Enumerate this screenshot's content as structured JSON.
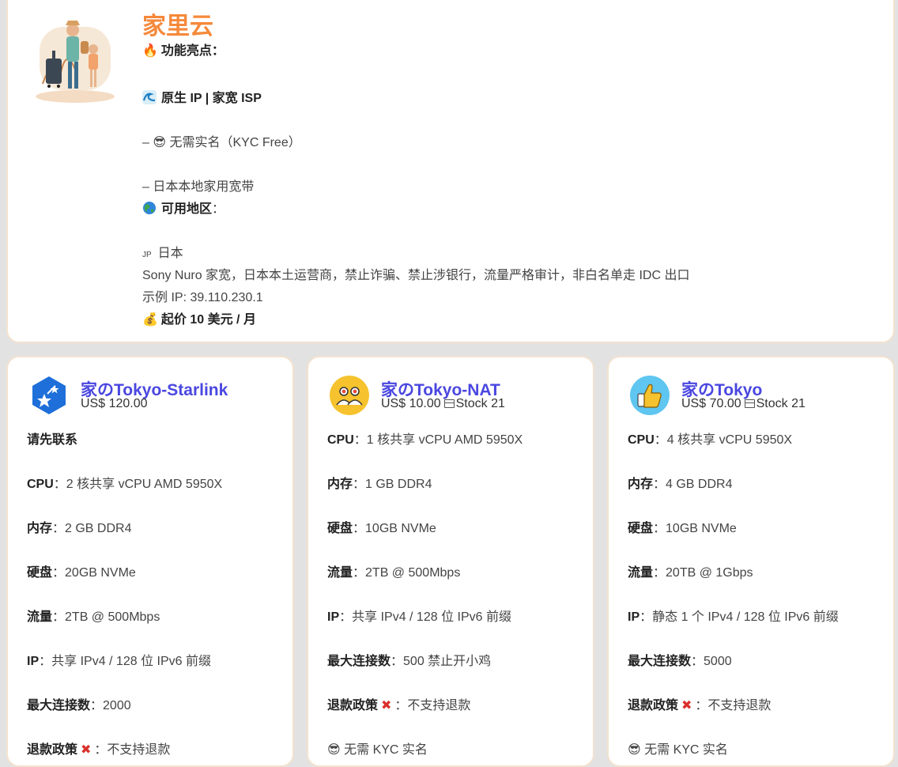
{
  "top": {
    "title": "家里云",
    "features_label": "功能亮点：",
    "native_label": "原生 IP | 家宽 ISP",
    "kyc_line": "– 😎 无需实名（KYC Free）",
    "broadband_line": "– 日本本地家用宽带",
    "region_label": "可用地区",
    "region_sep": "：",
    "jp_flag": "JP",
    "jp_name": "日本",
    "sony_line": "Sony Nuro 家宽，日本本土运营商，禁止诈骗、禁止涉银行，流量严格审计，非白名单走 IDC 出口",
    "example_ip": "示例 IP: 39.110.230.1",
    "price_label": "起价 10 美元 / 月"
  },
  "plans": [
    {
      "name": "家のTokyo-Starlink",
      "price": "US$ 120.00",
      "stock": "",
      "icon": "star-badge-icon",
      "specs": [
        {
          "label": "请先联系",
          "value": ""
        },
        {
          "label": "CPU",
          "value": "：2 核共享 vCPU AMD 5950X"
        },
        {
          "label": "内存",
          "value": "：2 GB DDR4"
        },
        {
          "label": "硬盘",
          "value": "：20GB NVMe"
        },
        {
          "label": "流量",
          "value": "：2TB @ 500Mbps"
        },
        {
          "label": "IP",
          "value": "：共享 IPv4 / 128 位 IPv6 前缀"
        },
        {
          "label": "最大连接数",
          "value": "：2000"
        },
        {
          "label": "退款政策",
          "value": "：不支持退款"
        }
      ]
    },
    {
      "name": "家のTokyo-NAT",
      "price": "US$ 10.00",
      "stock": "Stock 21",
      "icon": "users-icon",
      "specs": [
        {
          "label": "CPU",
          "value": "：1 核共享 vCPU AMD 5950X"
        },
        {
          "label": "内存",
          "value": "：1 GB DDR4"
        },
        {
          "label": "硬盘",
          "value": "：10GB NVMe"
        },
        {
          "label": "流量",
          "value": "：2TB @ 500Mbps"
        },
        {
          "label": "IP",
          "value": "：共享 IPv4 / 128 位 IPv6 前缀"
        },
        {
          "label": "最大连接数",
          "value": "：500 禁止开小鸡"
        },
        {
          "label": "退款政策",
          "value": "：不支持退款"
        },
        {
          "label": "",
          "value": "😎 无需 KYC 实名"
        }
      ]
    },
    {
      "name": "家のTokyo",
      "price": "US$ 70.00",
      "stock": "Stock 21",
      "icon": "thumbs-up-icon",
      "specs": [
        {
          "label": "CPU",
          "value": "：4 核共享 vCPU 5950X"
        },
        {
          "label": "内存",
          "value": "：4 GB DDR4"
        },
        {
          "label": "硬盘",
          "value": "：10GB NVMe"
        },
        {
          "label": "流量",
          "value": "：20TB @ 1Gbps"
        },
        {
          "label": "IP",
          "value": "：静态 1 个 IPv4 / 128 位 IPv6 前缀"
        },
        {
          "label": "最大连接数",
          "value": "：5000"
        },
        {
          "label": "退款政策",
          "value": "：不支持退款"
        },
        {
          "label": "",
          "value": "😎 无需 KYC 实名"
        }
      ]
    }
  ],
  "colors": {
    "brand": "#f5893b",
    "plan_name": "#4a47e0",
    "card_border": "#f3e2cf",
    "page_bg": "#e2e2e2",
    "refund_x": "#d9302b"
  }
}
